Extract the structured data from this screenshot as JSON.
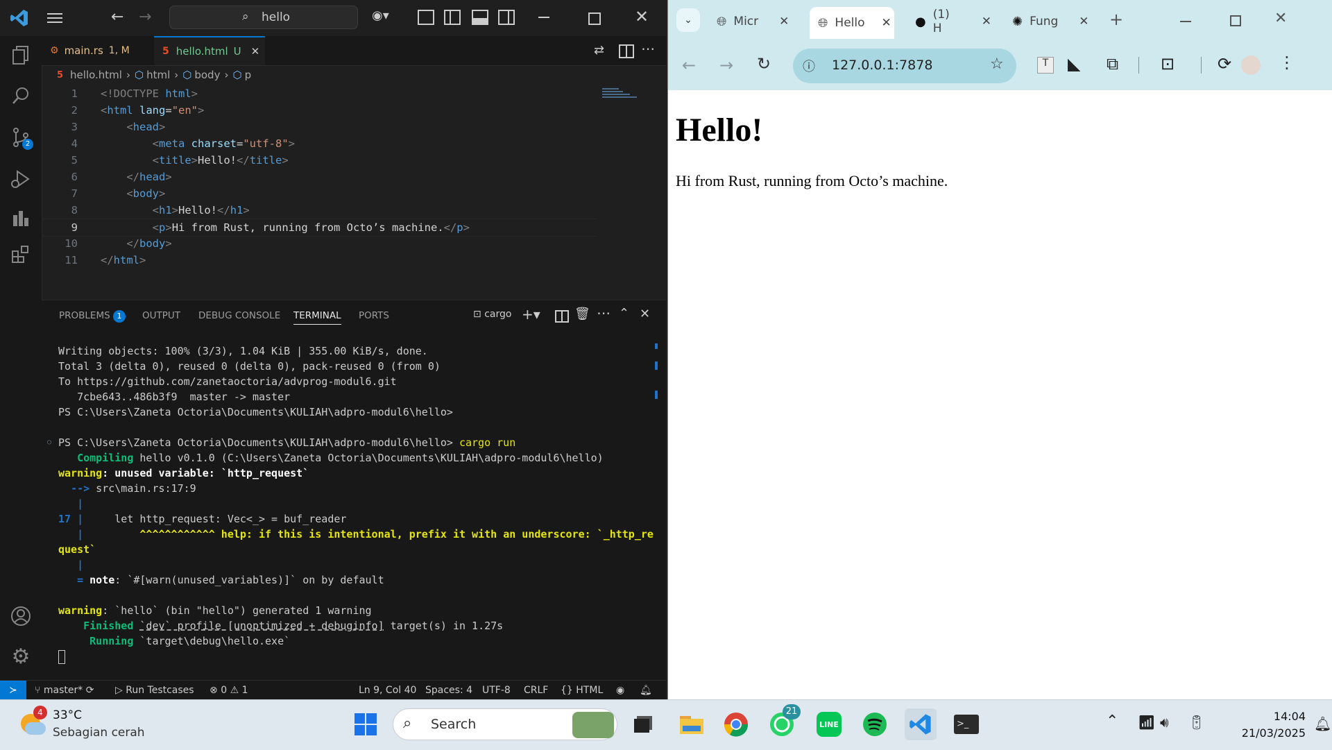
{
  "vscode": {
    "search": "hello",
    "tabs": [
      {
        "label": "main.rs",
        "badge": "1, M"
      },
      {
        "label": "hello.html",
        "badge": "U"
      }
    ],
    "breadcrumb": [
      "hello.html",
      "html",
      "body",
      "p"
    ],
    "code_lines": [
      {
        "n": "1"
      },
      {
        "n": "2"
      },
      {
        "n": "3"
      },
      {
        "n": "4"
      },
      {
        "n": "5"
      },
      {
        "n": "6"
      },
      {
        "n": "7"
      },
      {
        "n": "8"
      },
      {
        "n": "9"
      },
      {
        "n": "10"
      },
      {
        "n": "11"
      }
    ],
    "code": {
      "doctype": "<!DOCTYPE ",
      "doctype_html": "html",
      "html_open": "html",
      "lang_attr": "lang",
      "lang_val": "\"en\"",
      "head": "head",
      "meta": "meta",
      "charset_attr": "charset",
      "charset_val": "\"utf-8\"",
      "title": "title",
      "title_text": "Hello!",
      "body": "body",
      "h1": "h1",
      "h1_text": "Hello!",
      "p": "p",
      "p_text": "Hi from Rust, running from Octo’s machine."
    },
    "panel_tabs": [
      {
        "label": "PROBLEMS",
        "badge": "1"
      },
      {
        "label": "OUTPUT"
      },
      {
        "label": "DEBUG CONSOLE"
      },
      {
        "label": "TERMINAL"
      },
      {
        "label": "PORTS"
      }
    ],
    "terminal_name": "cargo",
    "terminal": {
      "l1": "Writing objects: 100% (3/3), 1.04 KiB | 355.00 KiB/s, done.",
      "l2": "Total 3 (delta 0), reused 0 (delta 0), pack-reused 0 (from 0)",
      "l3": "To https://github.com/zanetaoctoria/advprog-modul6.git",
      "l4": "   7cbe643..486b3f9  master -> master",
      "l5": "PS C:\\Users\\Zaneta Octoria\\Documents\\KULIAH\\adpro-modul6\\hello>",
      "prompt": "PS C:\\Users\\Zaneta Octoria\\Documents\\KULIAH\\adpro-modul6\\hello> ",
      "cmd": "cargo run",
      "compiling_kw": "Compiling",
      "compiling_rest": " hello v0.1.0 (C:\\Users\\Zaneta Octoria\\Documents\\KULIAH\\adpro-modul6\\hello)",
      "warning_kw": "warning",
      "warning_rest": ": unused variable: `http_request`",
      "arrow": "-->",
      "location": " src\\main.rs:17:9",
      "pipe": "|",
      "line_no": "17",
      "code_line": "    let http_request: Vec<_> = buf_reader",
      "carets": "^^^^^^^^^^^^",
      "help": " help: if this is intentional, prefix it with an underscore: `_http_re",
      "help_cont": "quest`",
      "note_eq": "=",
      "note_kw": "note",
      "note_rest": ": `#[warn(unused_variables)]` on by default",
      "warning2_kw": "warning",
      "warning2_rest": ": `hello` (bin \"hello\") generated 1 warning",
      "finished_kw": "Finished",
      "finished_profile": "`dev` profile [unoptimized + debuginfo]",
      "finished_rest": " target(s) in 1.27s",
      "running_kw": "Running",
      "running_rest": " `target\\debug\\hello.exe`"
    },
    "status": {
      "branch": "master*",
      "run_testcases": "Run Testcases",
      "errors": "0",
      "warnings": "1",
      "position": "Ln 9, Col 40",
      "spaces": "Spaces: 4",
      "encoding": "UTF-8",
      "eol": "CRLF",
      "language": "HTML"
    }
  },
  "chrome": {
    "tabs": [
      {
        "label": "Micr"
      },
      {
        "label": "Hello"
      },
      {
        "label": "(1) H"
      },
      {
        "label": "Fung"
      }
    ],
    "url": "127.0.0.1:7878",
    "page": {
      "h1": "Hello!",
      "p": "Hi from Rust, running from Octo’s machine."
    }
  },
  "taskbar": {
    "weather_temp": "33°C",
    "weather_desc": "Sebagian cerah",
    "weather_badge": "4",
    "search": "Search",
    "whatsapp_badge": "21",
    "time": "14:04",
    "date": "21/03/2025"
  },
  "colors": {
    "vscode_blue": "#0078d4",
    "chrome_tab_bg": "#cfe9ef",
    "terminal_yellow": "#e5e510",
    "terminal_green": "#0dbc79",
    "terminal_blue": "#2472c8"
  }
}
